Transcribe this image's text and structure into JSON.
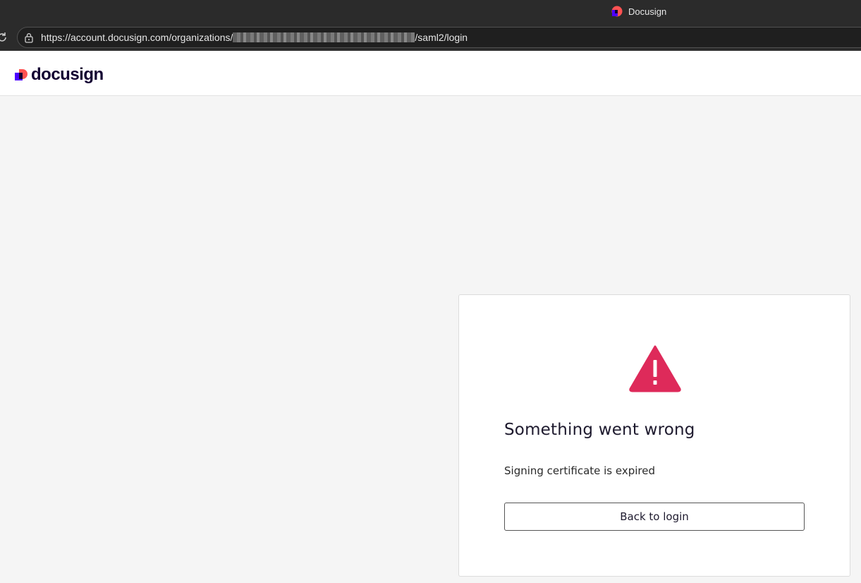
{
  "browser": {
    "tab_title": "Docusign",
    "url_prefix": "https://account.docusign.com/organizations/",
    "url_suffix": "/saml2/login"
  },
  "header": {
    "logo_text": "docusign"
  },
  "error_card": {
    "title": "Something went wrong",
    "message": "Signing certificate is expired",
    "button_label": "Back to login",
    "icon": "warning-triangle-icon",
    "accent_color": "#de2a5a"
  },
  "colors": {
    "brand_purple": "#4c00ff",
    "brand_coral": "#ff5252",
    "brand_dark": "#130032"
  }
}
